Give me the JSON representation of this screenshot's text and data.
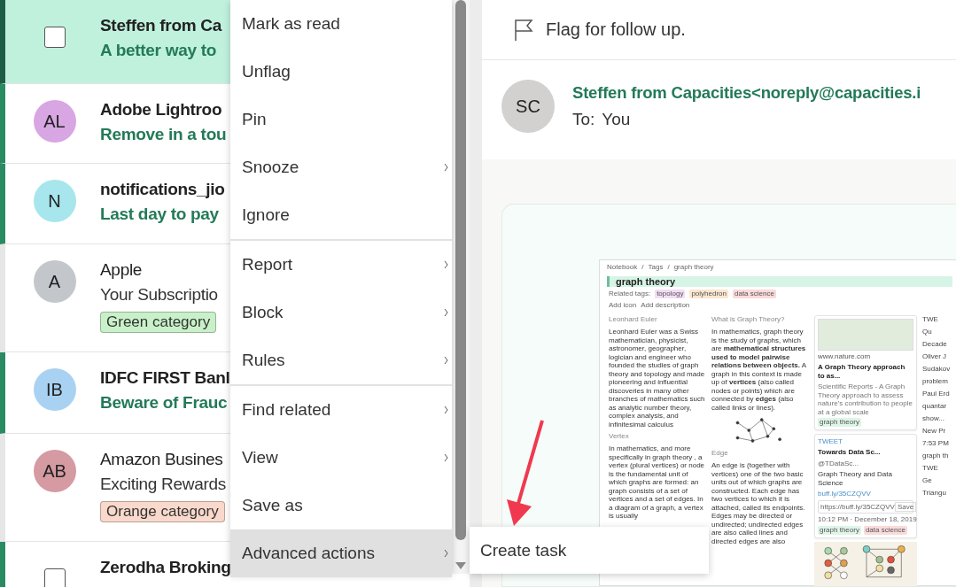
{
  "message_list": [
    {
      "kind": "checkbox",
      "sender": "Steffen from Ca",
      "preview": "A better way to",
      "unread": true,
      "selected": true,
      "checked": false
    },
    {
      "kind": "avatar",
      "initials": "AL",
      "color": "#d8a6e2",
      "sender": "Adobe Lightroo",
      "preview": "Remove in a tou",
      "unread": true,
      "selected": false
    },
    {
      "kind": "avatar",
      "initials": "N",
      "color": "#a6e6ec",
      "sender": "notifications_jio",
      "preview": "Last day to pay",
      "unread": true,
      "selected": false
    },
    {
      "kind": "avatar",
      "initials": "A",
      "color": "#c3c7cb",
      "sender": "Apple",
      "preview": "Your Subscriptio",
      "unread": false,
      "selected": false,
      "category": {
        "label": "Green category",
        "color": "#c9f1c9"
      }
    },
    {
      "kind": "avatar",
      "initials": "IB",
      "color": "#a9d2f2",
      "sender": "IDFC FIRST Banl",
      "preview": "Beware of Frauc",
      "unread": true,
      "selected": false
    },
    {
      "kind": "avatar",
      "initials": "AB",
      "color": "#d59aa2",
      "sender": "Amazon Busines",
      "preview": "Exciting Rewards",
      "unread": false,
      "selected": false,
      "category": {
        "label": "Orange category",
        "color": "#f9d9cb"
      }
    },
    {
      "kind": "checkbox",
      "sender": "Zerodha Broking",
      "unread": true,
      "selected": false,
      "checked": false
    }
  ],
  "context_menu": {
    "groups": [
      [
        {
          "label": "Mark as read",
          "has_submenu": false,
          "highlighted": false
        },
        {
          "label": "Unflag",
          "has_submenu": false,
          "highlighted": false
        },
        {
          "label": "Pin",
          "has_submenu": false,
          "highlighted": false
        },
        {
          "label": "Snooze",
          "has_submenu": true,
          "highlighted": false
        },
        {
          "label": "Ignore",
          "has_submenu": false,
          "highlighted": false
        }
      ],
      [
        {
          "label": "Report",
          "has_submenu": true,
          "highlighted": false
        },
        {
          "label": "Block",
          "has_submenu": true,
          "highlighted": false
        },
        {
          "label": "Rules",
          "has_submenu": true,
          "highlighted": false
        }
      ],
      [
        {
          "label": "Find related",
          "has_submenu": true,
          "highlighted": false
        },
        {
          "label": "View",
          "has_submenu": true,
          "highlighted": false
        },
        {
          "label": "Save as",
          "has_submenu": false,
          "highlighted": false
        },
        {
          "label": "Advanced actions",
          "has_submenu": true,
          "highlighted": true
        }
      ]
    ]
  },
  "submenu": {
    "items": [
      {
        "label": "Create task"
      }
    ]
  },
  "reading_pane": {
    "flag_action": "Flag for follow up.",
    "sender_initials": "SC",
    "sender": "Steffen from Capacities<noreply@capacities.i",
    "to_label": "To:",
    "to_value": "You",
    "embedded_page": {
      "breadcrumbs": [
        "Notebook",
        "/",
        "Tags",
        "/",
        "graph theory"
      ],
      "title": "graph theory",
      "related_label": "Related tags:",
      "tags": [
        {
          "label": "topology",
          "color": "#f3dcf5"
        },
        {
          "label": "polyhedron",
          "color": "#fbe6cf"
        },
        {
          "label": "data science",
          "color": "#fadada"
        }
      ],
      "actions": [
        "Add icon",
        "Add description"
      ],
      "col1": [
        {
          "heading": "Leonhard Euler",
          "text": "Leonhard Euler was a Swiss mathematician, physicist, astronomer, geographer, logician and engineer who founded the studies of graph theory and topology and made pioneering and influential discoveries in many other branches of mathematics such as analytic number theory, complex analysis, and infinitesimal calculus"
        },
        {
          "heading": "Vertex",
          "text": "In mathematics, and more specifically in graph theory , a vertex (plural vertices) or node is the fundamental unit of which graphs are formed: an graph consists of a set of vertices and a set of edges. In a diagram of a graph, a vertex is usually"
        }
      ],
      "col2": [
        {
          "heading": "What is Graph Theory?",
          "text": "In mathematics, graph theory is the study of graphs, which are **mathematical structures used to model pairwise relations between objects.** A graph in this context is made up of **vertices** (also called nodes or points) which are connected by **edges** (also called links or lines)."
        },
        {
          "heading": "Edge",
          "text": "An edge is (together with vertices) one of the two basic units out of which graphs are constructed. Each edge has two vertices to which it is attached, called its endpoints. Edges may be directed or undirected; undirected edges are also called lines and directed edges are also"
        }
      ],
      "link_card": {
        "site": "www.nature.com",
        "title": "A Graph Theory approach to as...",
        "description": "Scientific Reports - A Graph Theory approach to assess nature's contribution to people at a global scale",
        "tag": "graph theory"
      },
      "tweet_card": {
        "label": "TWEET",
        "author": "Towards Data Sc...",
        "handle": "@TDataSc...",
        "text": "Graph Theory and Data Science",
        "link": "buff.ly/35CZQVV",
        "field_value": "https://buff.ly/35CZQVV",
        "button": "Save",
        "time": "10:12 PM · December 18, 2019",
        "tags": [
          "graph theory",
          "data science"
        ]
      },
      "col4_lines": [
        "TWE",
        "Qu",
        "Decade",
        "Oliver J",
        "Sudakov",
        "problem",
        "Paul Erd",
        "quantar",
        "show...",
        "New Pr",
        "7:53 PM",
        "graph th",
        "TWE",
        "Ge",
        "Triangu"
      ]
    }
  }
}
